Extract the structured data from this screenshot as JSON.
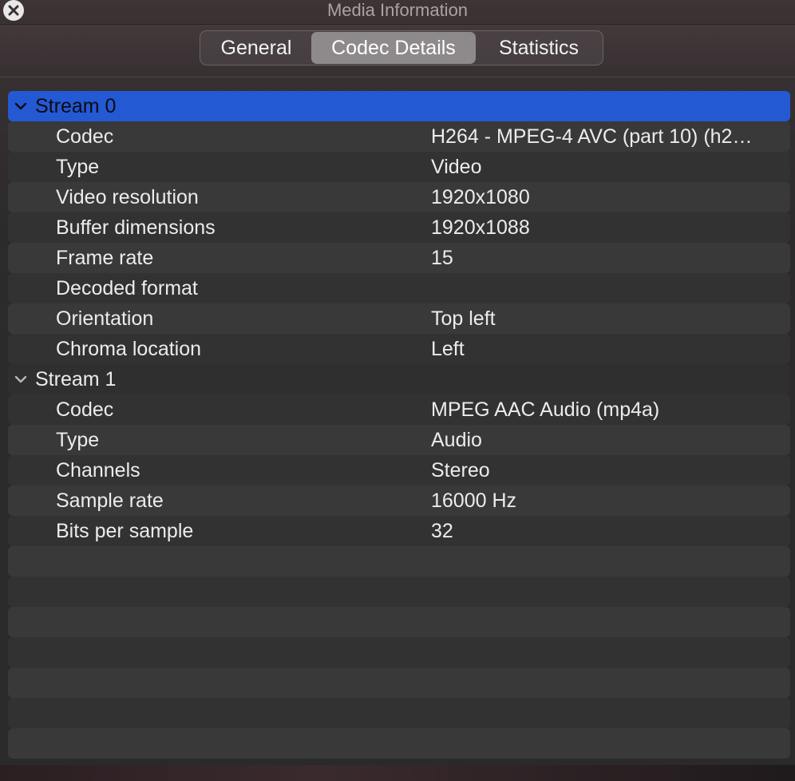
{
  "window": {
    "title": "Media Information"
  },
  "tabs": [
    {
      "label": "General",
      "selected": false
    },
    {
      "label": "Codec Details",
      "selected": true
    },
    {
      "label": "Statistics",
      "selected": false
    }
  ],
  "streams": [
    {
      "label": "Stream 0",
      "selected": true,
      "rows": [
        {
          "key": "Codec",
          "value": "H264 - MPEG-4 AVC (part 10) (h2…"
        },
        {
          "key": "Type",
          "value": "Video"
        },
        {
          "key": "Video resolution",
          "value": "1920x1080"
        },
        {
          "key": "Buffer dimensions",
          "value": "1920x1088"
        },
        {
          "key": "Frame rate",
          "value": "15"
        },
        {
          "key": "Decoded format",
          "value": ""
        },
        {
          "key": "Orientation",
          "value": "Top left"
        },
        {
          "key": "Chroma location",
          "value": "Left"
        }
      ]
    },
    {
      "label": "Stream 1",
      "selected": false,
      "rows": [
        {
          "key": "Codec",
          "value": "MPEG AAC Audio (mp4a)"
        },
        {
          "key": "Type",
          "value": "Audio"
        },
        {
          "key": "Channels",
          "value": "Stereo"
        },
        {
          "key": "Sample rate",
          "value": "16000 Hz"
        },
        {
          "key": "Bits per sample",
          "value": "32"
        }
      ]
    }
  ],
  "colors": {
    "selection": "#2459d4",
    "selected_tab": "#8e8a8b"
  },
  "icons": {
    "close": "close-icon",
    "expanded": "chevron-down-icon"
  }
}
